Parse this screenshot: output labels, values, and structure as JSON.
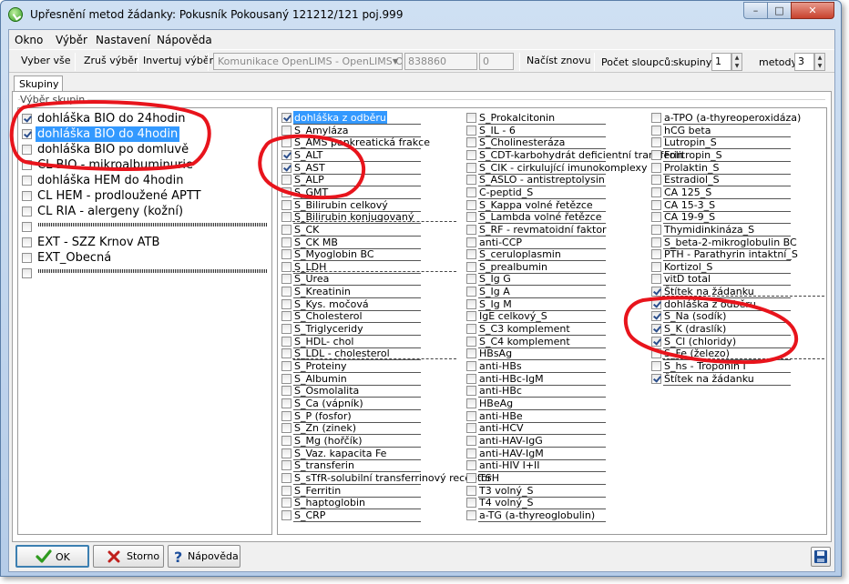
{
  "window": {
    "title": "Upřesnění metod žádanky: Pokusník Pokousaný 121212/121 poj.999",
    "min_glyph": "–",
    "max_glyph": "□",
    "close_glyph": "✕"
  },
  "menu": [
    "Okno",
    "Výběr",
    "Nastavení",
    "Nápověda"
  ],
  "toolbar": {
    "select_all": "Vyber vše",
    "clear_selection": "Zruš výběr",
    "invert_selection": "Invertuj výběr",
    "combo_value": "Komunikace OpenLIMS - OpenLIMS O",
    "field1": "838860",
    "field2": "0",
    "reload": "Načíst znovu",
    "columns_label": "Počet sloupců:",
    "groups_label": "skupiny",
    "groups_value": "1",
    "methods_label": "metody",
    "methods_value": "3"
  },
  "tab": {
    "label": "Skupiny",
    "group_title": "Výběr skupin"
  },
  "left_list": [
    {
      "label": "dohláška BIO do 24hodin",
      "checked": true,
      "selected": false
    },
    {
      "label": "dohláška BIO do 4hodin",
      "checked": true,
      "selected": true
    },
    {
      "label": "dohláška BIO po domluvě",
      "checked": false,
      "selected": false
    },
    {
      "label": "CL BIO - mikroalbuminurie",
      "checked": false,
      "selected": false
    },
    {
      "label": "dohláška HEM do 4hodin",
      "checked": false,
      "selected": false
    },
    {
      "label": "CL HEM - prodloužené APTT",
      "checked": false,
      "selected": false
    },
    {
      "label": "CL RIA - alergeny (kožní)",
      "checked": false,
      "selected": false
    },
    {
      "label": "",
      "checked": false,
      "selected": false
    },
    {
      "label": "EXT - SZZ Krnov ATB",
      "checked": false,
      "selected": false
    },
    {
      "label": "EXT_Obecná",
      "checked": false,
      "selected": false
    },
    {
      "label": "",
      "checked": false,
      "selected": false
    }
  ],
  "col1": [
    {
      "label": "dohláška z odběru",
      "checked": true,
      "selected": true
    },
    {
      "label": "S_Amyláza",
      "checked": false
    },
    {
      "label": "S_AMS pankreatická frakce",
      "checked": false
    },
    {
      "label": "S_ALT",
      "checked": true
    },
    {
      "label": "S_AST",
      "checked": true
    },
    {
      "label": "S_ALP",
      "checked": false
    },
    {
      "label": "S_GMT",
      "checked": false
    },
    {
      "label": "S_Bilirubin celkový",
      "checked": false
    },
    {
      "label": "S_Bilirubin konjugovaný",
      "checked": false
    },
    {
      "label": "S_CK",
      "checked": false
    },
    {
      "label": "S_CK MB",
      "checked": false
    },
    {
      "label": "S_Myoglobin BC",
      "checked": false
    },
    {
      "label": "S_LDH",
      "checked": false
    },
    {
      "label": "S_Urea",
      "checked": false
    },
    {
      "label": "S_Kreatinin",
      "checked": false
    },
    {
      "label": "S_Kys. močová",
      "checked": false
    },
    {
      "label": "S_Cholesterol",
      "checked": false
    },
    {
      "label": "S_Triglyceridy",
      "checked": false
    },
    {
      "label": "S_HDL- chol",
      "checked": false
    },
    {
      "label": "S_LDL - cholesterol",
      "checked": false
    },
    {
      "label": "S_Proteiny",
      "checked": false
    },
    {
      "label": "S_Albumin",
      "checked": false
    },
    {
      "label": "S_Osmolalita",
      "checked": false
    },
    {
      "label": "S_Ca (vápník)",
      "checked": false
    },
    {
      "label": "S_P (fosfor)",
      "checked": false
    },
    {
      "label": "S_Zn (zinek)",
      "checked": false
    },
    {
      "label": "S_Mg (hořčík)",
      "checked": false
    },
    {
      "label": "S_Vaz. kapacita Fe",
      "checked": false
    },
    {
      "label": "S_transferin",
      "checked": false
    },
    {
      "label": "S_sTfR-solubilní transferrinový receptor",
      "checked": false
    },
    {
      "label": "S_Ferritin",
      "checked": false
    },
    {
      "label": "S_haptoglobin",
      "checked": false
    },
    {
      "label": "S_CRP",
      "checked": false
    }
  ],
  "col2": [
    {
      "label": "S_Prokalcitonin",
      "checked": false
    },
    {
      "label": "S_IL - 6",
      "checked": false
    },
    {
      "label": "S_Cholinesteráza",
      "checked": false
    },
    {
      "label": "S_CDT-karbohydrát deficientní transferin",
      "checked": false
    },
    {
      "label": "S_CIK - cirkulující imunokomplexy",
      "checked": false
    },
    {
      "label": "S_ASLO - antistreptolysin",
      "checked": false
    },
    {
      "label": "C-peptid_S",
      "checked": false
    },
    {
      "label": "S_Kappa volné řetězce",
      "checked": false
    },
    {
      "label": "S_Lambda volné řetězce",
      "checked": false
    },
    {
      "label": "S_RF - revmatoidní faktor",
      "checked": false
    },
    {
      "label": "anti-CCP",
      "checked": false
    },
    {
      "label": "S_ceruloplasmin",
      "checked": false
    },
    {
      "label": "S_prealbumin",
      "checked": false
    },
    {
      "label": "S_Ig G",
      "checked": false
    },
    {
      "label": "S_Ig A",
      "checked": false
    },
    {
      "label": "S_Ig M",
      "checked": false
    },
    {
      "label": "IgE celkový_S",
      "checked": false
    },
    {
      "label": "S_C3 komplement",
      "checked": false
    },
    {
      "label": "S_C4 komplement",
      "checked": false
    },
    {
      "label": "HBsAg",
      "checked": false
    },
    {
      "label": "anti-HBs",
      "checked": false
    },
    {
      "label": "anti-HBc-IgM",
      "checked": false
    },
    {
      "label": "anti-HBc",
      "checked": false
    },
    {
      "label": "HBeAg",
      "checked": false
    },
    {
      "label": "anti-HBe",
      "checked": false
    },
    {
      "label": "anti-HCV",
      "checked": false
    },
    {
      "label": "anti-HAV-IgG",
      "checked": false
    },
    {
      "label": "anti-HAV-IgM",
      "checked": false
    },
    {
      "label": "anti-HIV I+II",
      "checked": false
    },
    {
      "label": "TSH",
      "checked": false
    },
    {
      "label": "T3 volný_S",
      "checked": false
    },
    {
      "label": "T4 volný_S",
      "checked": false
    },
    {
      "label": "a-TG (a-thyreoglobulin)",
      "checked": false
    }
  ],
  "col3": [
    {
      "label": "a-TPO (a-thyreoperoxidáza)",
      "checked": false
    },
    {
      "label": "hCG beta",
      "checked": false
    },
    {
      "label": "Lutropin_S",
      "checked": false
    },
    {
      "label": "Folitropin_S",
      "checked": false
    },
    {
      "label": "Prolaktin_S",
      "checked": false
    },
    {
      "label": "Estradiol_S",
      "checked": false
    },
    {
      "label": "CA 125_S",
      "checked": false
    },
    {
      "label": "CA 15-3_S",
      "checked": false
    },
    {
      "label": "CA 19-9_S",
      "checked": false
    },
    {
      "label": "Thymidinkináza_S",
      "checked": false
    },
    {
      "label": "S_beta-2-mikroglobulin BC",
      "checked": false
    },
    {
      "label": "PTH - Parathyrin intaktní_S",
      "checked": false
    },
    {
      "label": "Kortizol_S",
      "checked": false
    },
    {
      "label": "vitD total",
      "checked": false
    },
    {
      "label": "Štítek na žádanku",
      "checked": true
    },
    {
      "label": "dohláška z odběru",
      "checked": true
    },
    {
      "label": "S_Na (sodík)",
      "checked": true
    },
    {
      "label": "S_K (draslík)",
      "checked": true
    },
    {
      "label": "S_Cl (chloridy)",
      "checked": true
    },
    {
      "label": "S_Fe (železo)",
      "checked": false
    },
    {
      "label": "S_hs - Troponin I",
      "checked": false
    },
    {
      "label": "Štítek na žádanku",
      "checked": true
    }
  ],
  "buttons": {
    "ok": "OK",
    "storno": "Storno",
    "help": "Nápověda"
  },
  "colors": {
    "selection": "#3399ff",
    "annotation": "#e8141c",
    "ok_check": "#2e9a1e",
    "storno_x": "#c0201c"
  }
}
